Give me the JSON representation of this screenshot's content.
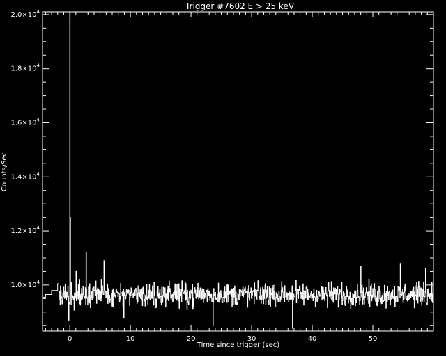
{
  "chart_data": {
    "type": "line",
    "title": "Trigger #7602 E > 25 keV",
    "xlabel": "Time since trigger (sec)",
    "ylabel": "Counts/Sec",
    "xlim": [
      -4.5,
      60
    ],
    "ylim": [
      8300,
      20100
    ],
    "x_ticks": [
      0,
      10,
      20,
      30,
      40,
      50
    ],
    "y_ticks": [
      {
        "value": 10000,
        "mantissa": "1.0",
        "exp": "4"
      },
      {
        "value": 12000,
        "mantissa": "1.2",
        "exp": "4"
      },
      {
        "value": 14000,
        "mantissa": "1.4",
        "exp": "4"
      },
      {
        "value": 16000,
        "mantissa": "1.6",
        "exp": "4"
      },
      {
        "value": 18000,
        "mantissa": "1.8",
        "exp": "4"
      },
      {
        "value": 20000,
        "mantissa": "2.0",
        "exp": "4"
      }
    ],
    "multiplier": "×10",
    "grid": false,
    "background": "#000000",
    "line_color": "#ffffff",
    "preamble_steps": {
      "x": [
        -4.5,
        -4.0,
        -3.0,
        -2.0,
        -1.8
      ],
      "y": [
        9550,
        9650,
        9800,
        10050,
        11100
      ]
    },
    "series": [
      {
        "x_start": -1.8,
        "x_step": 0.064,
        "baseline": 9650,
        "noise": 300,
        "spikes": [
          {
            "x": 0.0,
            "y": 20100
          },
          {
            "x": 0.064,
            "y": 12500
          },
          {
            "x": -0.2,
            "y": 8700
          },
          {
            "x": 2.7,
            "y": 11200
          },
          {
            "x": 1.0,
            "y": 10500
          },
          {
            "x": 5.6,
            "y": 10900
          },
          {
            "x": 8.9,
            "y": 8800
          },
          {
            "x": 23.6,
            "y": 8500
          },
          {
            "x": 36.7,
            "y": 8400
          },
          {
            "x": 48.0,
            "y": 10700
          },
          {
            "x": 54.5,
            "y": 10800
          },
          {
            "x": 58.7,
            "y": 10600
          }
        ]
      }
    ]
  }
}
